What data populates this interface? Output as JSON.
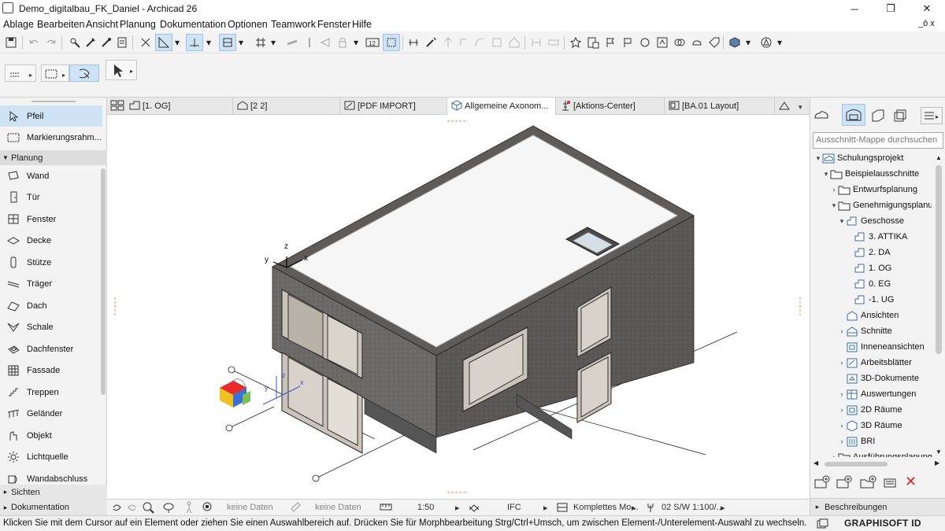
{
  "window": {
    "title": "Demo_digitalbau_FK_Daniel - Archicad 26",
    "minimize": "─",
    "restore": "❐",
    "close": "✕",
    "doc_restore": "_ō x"
  },
  "menu": [
    "Ablage",
    "Bearbeiten",
    "Ansicht",
    "Planung",
    "Dokumentation",
    "Optionen",
    "Teamwork",
    "Fenster",
    "Hilfe"
  ],
  "palette": {
    "items_top": [
      {
        "icon": "pointer-icon",
        "label": "Pfeil",
        "selected": true
      },
      {
        "icon": "marquee-icon",
        "label": "Markierungsrahm..."
      }
    ],
    "group_planung": "Planung",
    "items": [
      {
        "icon": "wall-icon",
        "label": "Wand"
      },
      {
        "icon": "door-icon",
        "label": "Tür"
      },
      {
        "icon": "window-icon",
        "label": "Fenster"
      },
      {
        "icon": "slab-icon",
        "label": "Decke"
      },
      {
        "icon": "column-icon",
        "label": "Stütze"
      },
      {
        "icon": "beam-icon",
        "label": "Träger"
      },
      {
        "icon": "roof-icon",
        "label": "Dach"
      },
      {
        "icon": "shell-icon",
        "label": "Schale"
      },
      {
        "icon": "skylight-icon",
        "label": "Dachfenster"
      },
      {
        "icon": "curtainwall-icon",
        "label": "Fassade"
      },
      {
        "icon": "stair-icon",
        "label": "Treppen"
      },
      {
        "icon": "railing-icon",
        "label": "Geländer"
      },
      {
        "icon": "object-icon",
        "label": "Objekt"
      },
      {
        "icon": "lamp-icon",
        "label": "Lichtquelle"
      },
      {
        "icon": "wallend-icon",
        "label": "Wandabschluss"
      }
    ],
    "group_sichten": "Sichten",
    "group_dokumentation": "Dokumentation"
  },
  "tabs": [
    {
      "label": "[1. OG]",
      "icon": "floorplan-icon"
    },
    {
      "label": "[2 2]",
      "icon": "section-icon"
    },
    {
      "label": "[PDF IMPORT]",
      "icon": "drawing-icon"
    },
    {
      "label": "Allgemeine Axonom...",
      "icon": "3d-icon",
      "active": true,
      "close": "✕"
    },
    {
      "label": "[Aktions-Center]",
      "icon": "actioncenter-icon"
    },
    {
      "label": "[BA.01 Layout]",
      "icon": "layout-icon"
    }
  ],
  "viewport": {
    "axes": {
      "x": "x",
      "y": "y",
      "z": "z"
    },
    "ucs": {
      "x": "x",
      "y": "y",
      "z": "z"
    }
  },
  "viewbar": {
    "no_data_1": "keine Daten",
    "no_data_2": "keine Daten",
    "scale": "1:50",
    "ifc": "IFC",
    "model_view": "Komplettes Mo...",
    "pen_set": "02 S/W 1:100/..."
  },
  "navigator": {
    "search_placeholder": "Ausschnitt-Mappe durchsuchen",
    "tree": [
      {
        "label": "Schulungsprojekt",
        "level": 0,
        "arrow": "▾",
        "icon": "project-icon"
      },
      {
        "label": "Beispielausschnitte",
        "level": 1,
        "arrow": "▾",
        "icon": "folder-icon"
      },
      {
        "label": "Entwurfsplanung",
        "level": 2,
        "arrow": "›",
        "icon": "folder-icon"
      },
      {
        "label": "Genehmigungsplanun",
        "level": 2,
        "arrow": "▾",
        "icon": "folder-icon"
      },
      {
        "label": "Geschosse",
        "level": 3,
        "arrow": "▾",
        "icon": "stories-icon"
      },
      {
        "label": "3. ATTIKA",
        "level": 4,
        "arrow": "",
        "icon": "story-icon"
      },
      {
        "label": "2. DA",
        "level": 4,
        "arrow": "",
        "icon": "story-icon"
      },
      {
        "label": "1. OG",
        "level": 4,
        "arrow": "",
        "icon": "story-icon"
      },
      {
        "label": "0. EG",
        "level": 4,
        "arrow": "",
        "icon": "story-icon"
      },
      {
        "label": "-1. UG",
        "level": 4,
        "arrow": "",
        "icon": "story-icon"
      },
      {
        "label": "Ansichten",
        "level": 3,
        "arrow": "",
        "icon": "elevation-icon"
      },
      {
        "label": "Schnitte",
        "level": 3,
        "arrow": "›",
        "icon": "section-icon"
      },
      {
        "label": "Inneneansichten",
        "level": 3,
        "arrow": "",
        "icon": "interior-icon"
      },
      {
        "label": "Arbeitsblätter",
        "level": 3,
        "arrow": "›",
        "icon": "worksheet-icon"
      },
      {
        "label": "3D-Dokumente",
        "level": 3,
        "arrow": "",
        "icon": "3ddoc-icon"
      },
      {
        "label": "Auswertungen",
        "level": 3,
        "arrow": "›",
        "icon": "schedule-icon"
      },
      {
        "label": "2D Räume",
        "level": 3,
        "arrow": "›",
        "icon": "zone2d-icon"
      },
      {
        "label": "3D Räume",
        "level": 3,
        "arrow": "›",
        "icon": "zone3d-icon"
      },
      {
        "label": "BRI",
        "level": 3,
        "arrow": "›",
        "icon": "bri-icon"
      },
      {
        "label": "Ausführungsplanung",
        "level": 2,
        "arrow": "›",
        "icon": "folder-icon"
      }
    ],
    "beschreibungen": "Beschreibungen"
  },
  "status": {
    "hint": "Klicken Sie mit dem Cursor auf ein Element oder ziehen Sie einen Auswahlbereich auf. Drücken Sie für Morphbearbeitung Strg/Ctrl+Umsch, um zwischen Element-/Unterelement-Auswahl zu wechseln.",
    "brand": "GRAPHISOFT ID"
  },
  "colors": {
    "accent": "#cfe3f5",
    "close_red": "#d9261c",
    "concrete": "#6b6866",
    "concrete_dark": "#4f4c4a"
  }
}
